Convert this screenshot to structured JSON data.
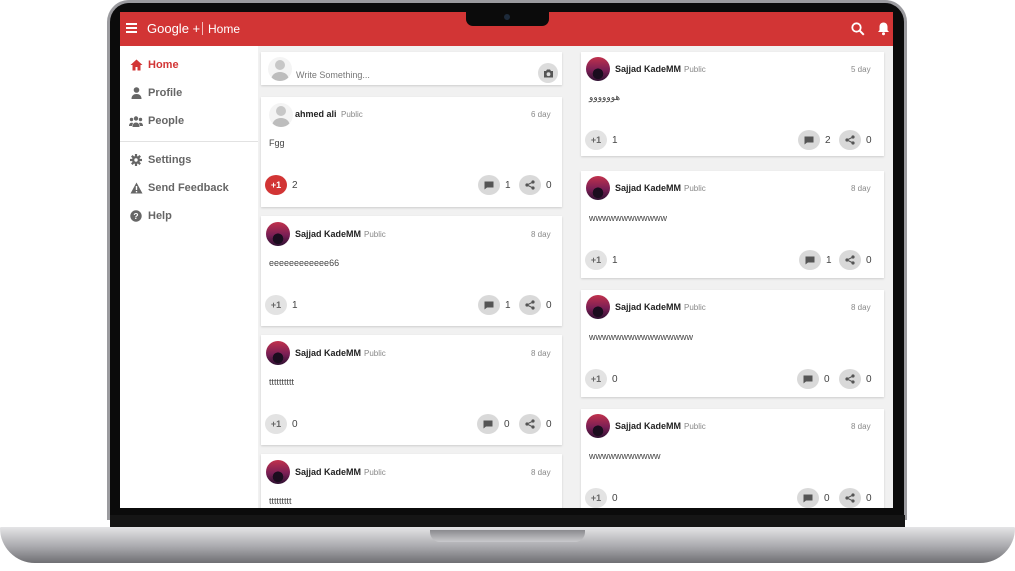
{
  "app": {
    "title": "Google +",
    "crumb": "Home",
    "accent": "#d23535"
  },
  "sidebar": {
    "items": [
      {
        "label": "Home",
        "icon": "home-icon"
      },
      {
        "label": "Profile",
        "icon": "person-icon"
      },
      {
        "label": "People",
        "icon": "people-icon"
      },
      {
        "label": "Settings",
        "icon": "gear-icon"
      },
      {
        "label": "Send Feedback",
        "icon": "warning-icon"
      },
      {
        "label": "Help",
        "icon": "help-icon"
      }
    ]
  },
  "compose": {
    "placeholder": "Write Something..."
  },
  "feed_left": [
    {
      "author": "ahmed ali",
      "visibility": "Public",
      "time": "6 day",
      "text": "Fgg",
      "plus": "+1",
      "plus_count": "2",
      "comments": "1",
      "shares": "0"
    },
    {
      "author": "Sajjad KadeMM",
      "visibility": "Public",
      "time": "8 day",
      "text": "eeeeeeeeeeee66",
      "plus": "+1",
      "plus_count": "1",
      "comments": "1",
      "shares": "0"
    },
    {
      "author": "Sajjad KadeMM",
      "visibility": "Public",
      "time": "8 day",
      "text": "tttttttttt",
      "plus": "+1",
      "plus_count": "0",
      "comments": "0",
      "shares": "0"
    },
    {
      "author": "Sajjad KadeMM",
      "visibility": "Public",
      "time": "8 day",
      "text": "ttttttttt"
    }
  ],
  "feed_right": [
    {
      "author": "Sajjad KadeMM",
      "visibility": "Public",
      "time": "5 day",
      "text": "هوووووو",
      "plus": "+1",
      "plus_count": "1",
      "comments": "2",
      "shares": "0"
    },
    {
      "author": "Sajjad KadeMM",
      "visibility": "Public",
      "time": "8 day",
      "text": "wwwwwwwwwwww",
      "plus": "+1",
      "plus_count": "1",
      "comments": "1",
      "shares": "0"
    },
    {
      "author": "Sajjad KadeMM",
      "visibility": "Public",
      "time": "8 day",
      "text": "wwwwwwwwwwwwwwww",
      "plus": "+1",
      "plus_count": "0",
      "comments": "0",
      "shares": "0"
    },
    {
      "author": "Sajjad KadeMM",
      "visibility": "Public",
      "time": "8 day",
      "text": "wwwwwwwwwww",
      "plus": "+1",
      "plus_count": "0",
      "comments": "0",
      "shares": "0"
    }
  ]
}
